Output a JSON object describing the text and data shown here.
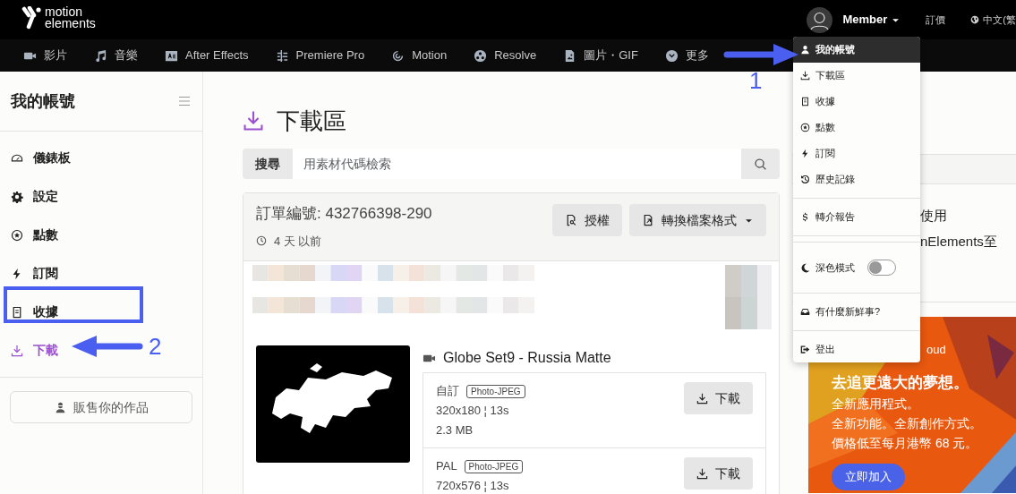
{
  "header": {
    "logo": [
      "motion",
      "elements"
    ],
    "user": "Member",
    "pricing": "訂價",
    "language": "中文(繁"
  },
  "nav": [
    {
      "label": "影片"
    },
    {
      "label": "音樂"
    },
    {
      "label": "After Effects"
    },
    {
      "label": "Premiere Pro"
    },
    {
      "label": "Motion"
    },
    {
      "label": "Resolve"
    },
    {
      "label": "圖片・GIF"
    },
    {
      "label": "更多"
    }
  ],
  "sidebar": {
    "title": "我的帳號",
    "items": [
      {
        "label": "儀錶板",
        "selected": false
      },
      {
        "label": "設定",
        "selected": false
      },
      {
        "label": "點數",
        "selected": false
      },
      {
        "label": "訂閱",
        "selected": false
      },
      {
        "label": "收據",
        "selected": false
      },
      {
        "label": "下載",
        "selected": true
      }
    ],
    "sell_button": "販售你的作品"
  },
  "main": {
    "title": "下載區",
    "search": {
      "label": "搜尋",
      "placeholder": "用素材代碼檢索"
    },
    "order": {
      "number": "訂單編號: 432766398-290",
      "time": "4 天 以前",
      "license_button": "授權",
      "convert_button": "轉換檔案格式",
      "item": {
        "title": "Globe Set9 - Russia Matte",
        "formats": [
          {
            "name": "自訂",
            "codec": "Photo-JPEG",
            "size": "320x180 ¦ 13s",
            "filesize": "2.3 MB",
            "button": "下載"
          },
          {
            "name": "PAL",
            "codec": "Photo-JPEG",
            "size": "720x576 ¦ 13s",
            "button": "下載"
          }
        ]
      }
    }
  },
  "right_panel": {
    "lines": [
      "使用",
      "nElements至"
    ],
    "ad": {
      "brand": "oud",
      "headline": "去追更遠大的夢想。",
      "lines": [
        "全新應用程式。",
        "全新功能。全新創作方式。",
        "價格低至每月港幣 68 元。"
      ],
      "button": "立即加入"
    }
  },
  "dropdown": {
    "items": [
      {
        "kind": "link",
        "label": "我的帳號",
        "selected": true
      },
      {
        "kind": "link",
        "label": "下載區",
        "selected": false
      },
      {
        "kind": "link",
        "label": "收據",
        "selected": false
      },
      {
        "kind": "link",
        "label": "點數",
        "selected": false
      },
      {
        "kind": "link",
        "label": "訂閱",
        "selected": false
      },
      {
        "kind": "link",
        "label": "歷史記錄",
        "selected": false
      },
      {
        "kind": "divider"
      },
      {
        "kind": "link",
        "label": "轉介報告",
        "selected": false
      },
      {
        "kind": "divider"
      },
      {
        "kind": "divider"
      },
      {
        "kind": "toggle",
        "label": "深色模式",
        "on": false
      },
      {
        "kind": "divider"
      },
      {
        "kind": "link",
        "label": "有什麼新鮮事?",
        "selected": false
      },
      {
        "kind": "divider"
      },
      {
        "kind": "link",
        "label": "登出",
        "selected": false
      }
    ]
  },
  "annotations": [
    {
      "label": "1"
    },
    {
      "label": "2"
    }
  ]
}
